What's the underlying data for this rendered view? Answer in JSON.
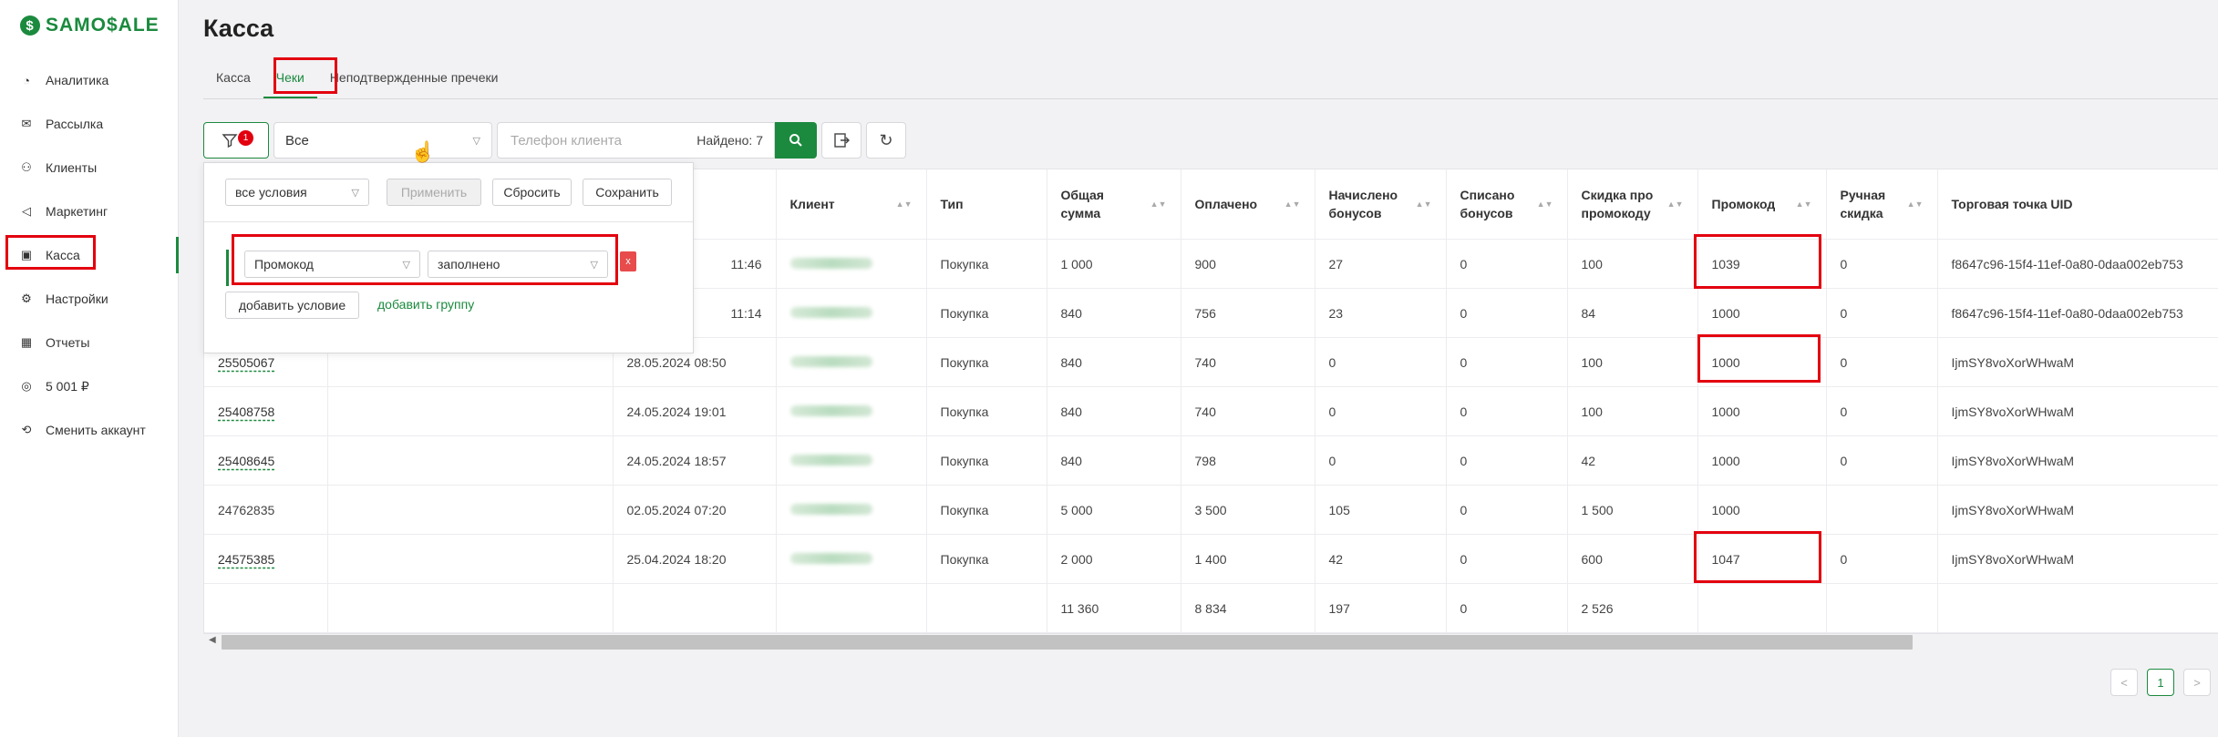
{
  "brand": {
    "name": "SAMO$ALE",
    "mark": "$"
  },
  "sidebar": {
    "items": [
      {
        "label": "Аналитика",
        "icon": "pie-chart-icon"
      },
      {
        "label": "Рассылка",
        "icon": "mail-icon"
      },
      {
        "label": "Клиенты",
        "icon": "users-icon"
      },
      {
        "label": "Маркетинг",
        "icon": "megaphone-icon"
      },
      {
        "label": "Касса",
        "icon": "cash-register-icon",
        "active": true
      },
      {
        "label": "Настройки",
        "icon": "gear-icon"
      },
      {
        "label": "Отчеты",
        "icon": "table-icon"
      },
      {
        "label": "5 001 ₽",
        "icon": "coins-icon"
      },
      {
        "label": "Сменить аккаунт",
        "icon": "switch-account-icon"
      }
    ]
  },
  "page": {
    "title": "Касса"
  },
  "tabs": [
    {
      "label": "Касса"
    },
    {
      "label": "Чеки",
      "active": true
    },
    {
      "label": "Неподтвержденные пречеки"
    }
  ],
  "toolbar": {
    "filter_badge": "1",
    "status_select": "Все",
    "phone_placeholder": "Телефон клиента",
    "found_text": "Найдено: 7"
  },
  "filter_panel": {
    "conditions_select": "все условия",
    "apply_label": "Применить",
    "reset_label": "Сбросить",
    "save_label": "Сохранить",
    "field_select": "Промокод",
    "operator_select": "заполнено",
    "remove_label": "x",
    "add_condition_label": "добавить условие",
    "add_group_label": "добавить группу"
  },
  "table": {
    "headers": [
      "",
      "",
      "",
      "Клиент",
      "Тип",
      "Общая сумма",
      "Оплачено",
      "Начислено бонусов",
      "Списано бонусов",
      "Скидка про промокоду",
      "Промокод",
      "Ручная скидка",
      "Торговая точка UID"
    ],
    "rows": [
      {
        "id": "",
        "date": "11:46",
        "type": "Покупка",
        "total": "1 000",
        "paid": "900",
        "accrued": "27",
        "written_off": "0",
        "promo_discount": "100",
        "promo": "1039",
        "manual": "0",
        "uid": "f8647c96-15f4-11ef-0a80-0daa002eb753"
      },
      {
        "id": "",
        "date": "11:14",
        "type": "Покупка",
        "total": "840",
        "paid": "756",
        "accrued": "23",
        "written_off": "0",
        "promo_discount": "84",
        "promo": "1000",
        "manual": "0",
        "uid": "f8647c96-15f4-11ef-0a80-0daa002eb753"
      },
      {
        "id": "25505067",
        "date": "28.05.2024 08:50",
        "type": "Покупка",
        "total": "840",
        "paid": "740",
        "accrued": "0",
        "written_off": "0",
        "promo_discount": "100",
        "promo": "1000",
        "manual": "0",
        "uid": "IjmSY8voXorWHwaM"
      },
      {
        "id": "25408758",
        "date": "24.05.2024 19:01",
        "type": "Покупка",
        "total": "840",
        "paid": "740",
        "accrued": "0",
        "written_off": "0",
        "promo_discount": "100",
        "promo": "1000",
        "manual": "0",
        "uid": "IjmSY8voXorWHwaM"
      },
      {
        "id": "25408645",
        "date": "24.05.2024 18:57",
        "type": "Покупка",
        "total": "840",
        "paid": "798",
        "accrued": "0",
        "written_off": "0",
        "promo_discount": "42",
        "promo": "1000",
        "manual": "0",
        "uid": "IjmSY8voXorWHwaM"
      },
      {
        "id": "24762835",
        "date": "02.05.2024 07:20",
        "type": "Покупка",
        "total": "5 000",
        "paid": "3 500",
        "accrued": "105",
        "written_off": "0",
        "promo_discount": "1 500",
        "promo": "1000",
        "manual": "",
        "uid": "IjmSY8voXorWHwaM"
      },
      {
        "id": "24575385",
        "date": "25.04.2024 18:20",
        "type": "Покупка",
        "total": "2 000",
        "paid": "1 400",
        "accrued": "42",
        "written_off": "0",
        "promo_discount": "600",
        "promo": "1047",
        "manual": "0",
        "uid": "IjmSY8voXorWHwaM"
      }
    ],
    "totals": {
      "total": "11 360",
      "paid": "8 834",
      "accrued": "197",
      "written_off": "0",
      "promo_discount": "2 526"
    }
  },
  "pagination": {
    "prev": "<",
    "page": "1",
    "next": ">"
  },
  "colors": {
    "accent": "#1b8a3e",
    "highlight": "#e3000f"
  }
}
